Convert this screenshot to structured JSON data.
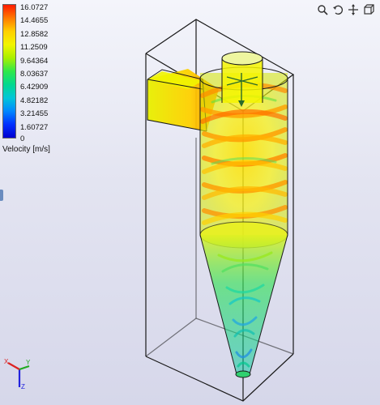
{
  "legend": {
    "title": "Velocity [m/s]",
    "ticks": [
      "16.0727",
      "14.4655",
      "12.8582",
      "11.2509",
      "9.64364",
      "8.03637",
      "6.42909",
      "4.82182",
      "3.21455",
      "1.60727",
      "0"
    ],
    "colormap": [
      "#ff1a00",
      "#ff7a00",
      "#ffd000",
      "#f2f500",
      "#a8f000",
      "#2ee84a",
      "#00d890",
      "#00c6d8",
      "#0088ff",
      "#0030ff",
      "#0000d0"
    ]
  },
  "toolbar": {
    "icons": [
      "zoom-icon",
      "rotate-icon",
      "pan-icon",
      "view-icon"
    ]
  },
  "triad": {
    "x": "X",
    "y": "Y",
    "z": "Z"
  }
}
